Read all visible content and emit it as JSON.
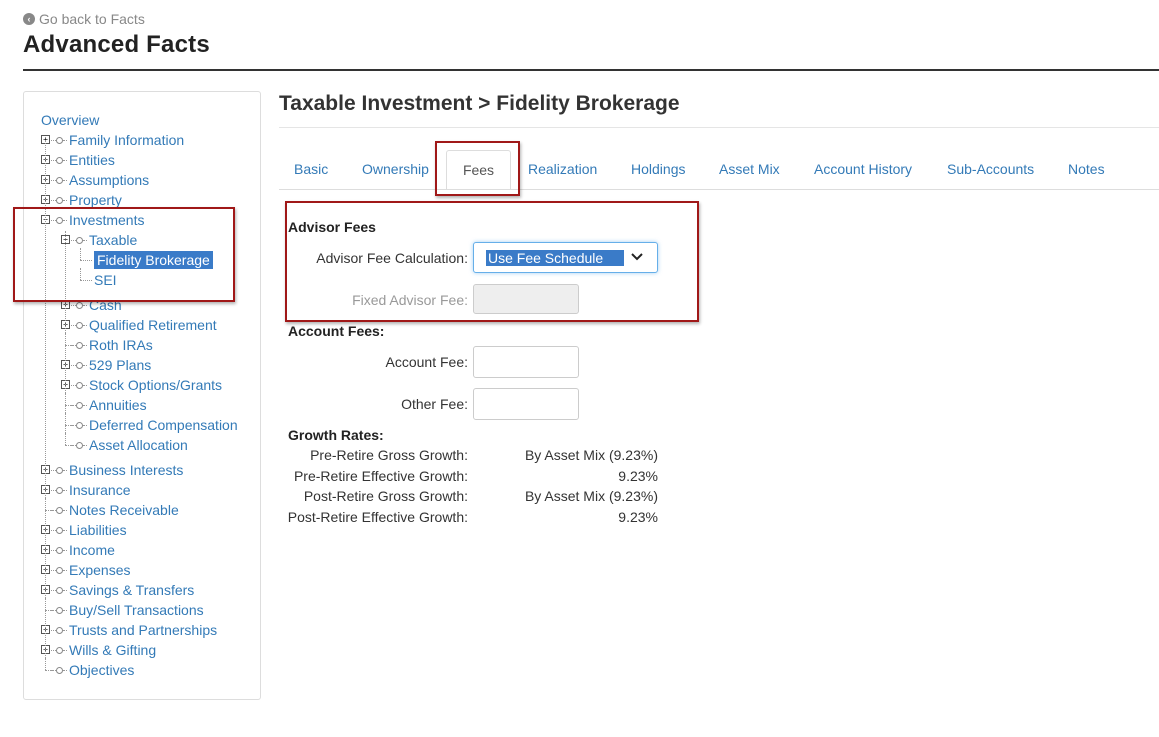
{
  "header": {
    "back_label": "Go back to Facts",
    "title": "Advanced Facts"
  },
  "sidebar": {
    "overview": "Overview",
    "items": [
      {
        "label": "Family Information",
        "expandable": true
      },
      {
        "label": "Entities",
        "expandable": true
      },
      {
        "label": "Assumptions",
        "expandable": true
      },
      {
        "label": "Property",
        "expandable": true
      },
      {
        "label": "Investments",
        "expandable": true,
        "expanded": true
      }
    ],
    "investments_children": [
      {
        "label": "Taxable",
        "expandable": true,
        "expanded": true
      },
      {
        "label": "Cash",
        "expandable": true
      },
      {
        "label": "Qualified Retirement",
        "expandable": true
      },
      {
        "label": "Roth IRAs",
        "expandable": false
      },
      {
        "label": "529 Plans",
        "expandable": true
      },
      {
        "label": "Stock Options/Grants",
        "expandable": true
      },
      {
        "label": "Annuities",
        "expandable": false
      },
      {
        "label": "Deferred Compensation",
        "expandable": false
      },
      {
        "label": "Asset Allocation",
        "expandable": false
      }
    ],
    "taxable_children": [
      {
        "label": "Fidelity Brokerage",
        "selected": true
      },
      {
        "label": "SEI",
        "selected": false
      }
    ],
    "rest_items": [
      {
        "label": "Business Interests",
        "expandable": true
      },
      {
        "label": "Insurance",
        "expandable": true
      },
      {
        "label": "Notes Receivable",
        "expandable": false
      },
      {
        "label": "Liabilities",
        "expandable": true
      },
      {
        "label": "Income",
        "expandable": true
      },
      {
        "label": "Expenses",
        "expandable": true
      },
      {
        "label": "Savings & Transfers",
        "expandable": true
      },
      {
        "label": "Buy/Sell Transactions",
        "expandable": false
      },
      {
        "label": "Trusts and Partnerships",
        "expandable": true
      },
      {
        "label": "Wills & Gifting",
        "expandable": true
      },
      {
        "label": "Objectives",
        "expandable": false
      }
    ]
  },
  "main": {
    "section_title": "Taxable Investment > Fidelity Brokerage",
    "tabs": [
      "Basic",
      "Ownership",
      "Fees",
      "Realization",
      "Holdings",
      "Asset Mix",
      "Account History",
      "Sub-Accounts",
      "Notes"
    ],
    "active_tab": "Fees",
    "advisor_fees": {
      "heading": "Advisor Fees",
      "calc_label": "Advisor Fee Calculation:",
      "calc_value": "Use Fee Schedule",
      "fixed_label": "Fixed Advisor Fee:",
      "fixed_value": ""
    },
    "account_fees": {
      "heading": "Account Fees:",
      "account_fee_label": "Account Fee:",
      "account_fee_value": "",
      "other_fee_label": "Other Fee:",
      "other_fee_value": ""
    },
    "growth_rates": {
      "heading": "Growth Rates:",
      "rows": [
        {
          "label": "Pre-Retire Gross Growth:",
          "value": "By Asset Mix (9.23%)"
        },
        {
          "label": "Pre-Retire Effective Growth:",
          "value": "9.23%"
        },
        {
          "label": "Post-Retire Gross Growth:",
          "value": "By Asset Mix (9.23%)"
        },
        {
          "label": "Post-Retire Effective Growth:",
          "value": "9.23%"
        }
      ]
    }
  },
  "colors": {
    "link": "#337ab7",
    "highlight_border": "#a01818",
    "selected_bg": "#3a7bc8"
  }
}
